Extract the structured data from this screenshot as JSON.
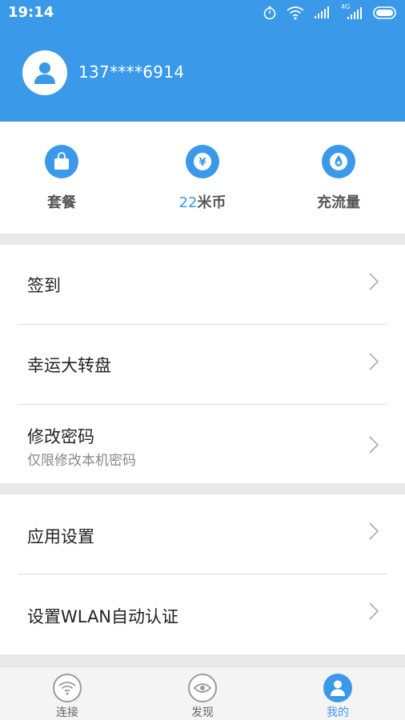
{
  "status_bar": {
    "time": "19:14",
    "network_label": "4G"
  },
  "profile": {
    "phone": "137****6914"
  },
  "quick_actions": [
    {
      "label": "套餐",
      "icon": "bag-icon"
    },
    {
      "count": "22",
      "unit": "米币",
      "icon": "yen-coin-icon"
    },
    {
      "label": "充流量",
      "icon": "droplet-plus-icon"
    }
  ],
  "menu": {
    "group1": [
      {
        "label": "签到"
      },
      {
        "label": "幸运大转盘"
      },
      {
        "label": "修改密码",
        "sublabel": "仅限修改本机密码"
      }
    ],
    "group2": [
      {
        "label": "应用设置"
      },
      {
        "label": "设置WLAN自动认证"
      }
    ]
  },
  "tabs": [
    {
      "label": "连接",
      "icon": "wifi-icon",
      "active": false
    },
    {
      "label": "发现",
      "icon": "eye-icon",
      "active": false
    },
    {
      "label": "我的",
      "icon": "user-icon",
      "active": true
    }
  ],
  "colors": {
    "accent": "#3b99ea",
    "background": "#e9e9e9",
    "text": "#222222",
    "muted": "#888888"
  }
}
